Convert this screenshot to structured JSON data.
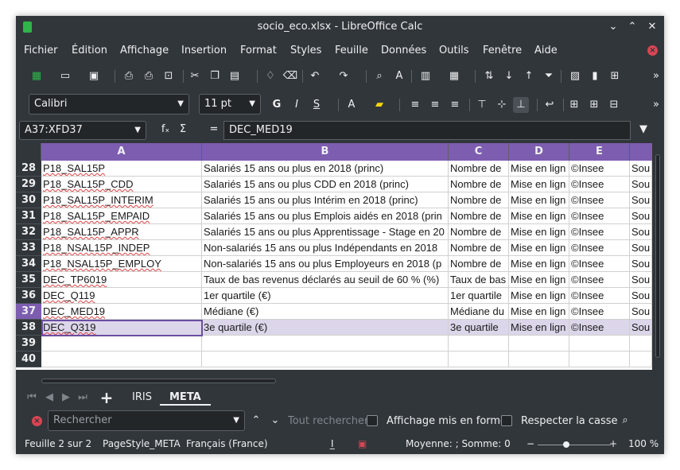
{
  "window": {
    "title": "socio_eco.xlsx - LibreOffice Calc",
    "minimize_glyph": "⌄",
    "maximize_glyph": "⌃",
    "close_glyph": "✕"
  },
  "menu": {
    "items": [
      "Fichier",
      "Édition",
      "Affichage",
      "Insertion",
      "Format",
      "Styles",
      "Feuille",
      "Données",
      "Outils",
      "Fenêtre",
      "Aide"
    ]
  },
  "toolbar": {
    "font_name": "Calibri",
    "font_size": "11 pt",
    "bold": "G",
    "italic": "I",
    "underline": "S",
    "more": "»"
  },
  "formula_bar": {
    "name_box": "A37:XFD37",
    "fx": "fₓ",
    "sigma": "Σ",
    "equals": "=",
    "content": "DEC_MED19"
  },
  "grid": {
    "columns": [
      "A",
      "B",
      "C",
      "D",
      "E"
    ],
    "rows": [
      {
        "num": "28",
        "a": "P18_SAL15P",
        "b": "Salariés 15 ans ou plus en 2018 (princ)",
        "c": "Nombre de",
        "d": "Mise en lign",
        "e": "©Insee",
        "f": "Sou"
      },
      {
        "num": "29",
        "a": "P18_SAL15P_CDD",
        "b": "Salariés 15 ans ou plus CDD en 2018 (princ)",
        "c": "Nombre de",
        "d": "Mise en lign",
        "e": "©Insee",
        "f": "Sou"
      },
      {
        "num": "30",
        "a": "P18_SAL15P_INTERIM",
        "b": "Salariés 15 ans ou plus Intérim en 2018 (princ)",
        "c": "Nombre de",
        "d": "Mise en lign",
        "e": "©Insee",
        "f": "Sou"
      },
      {
        "num": "31",
        "a": "P18_SAL15P_EMPAID",
        "b": "Salariés 15 ans ou plus Emplois aidés en 2018 (prin",
        "c": "Nombre de",
        "d": "Mise en lign",
        "e": "©Insee",
        "f": "Sou"
      },
      {
        "num": "32",
        "a": "P18_SAL15P_APPR",
        "b": "Salariés 15 ans ou plus Apprentissage - Stage en 20",
        "c": "Nombre de",
        "d": "Mise en lign",
        "e": "©Insee",
        "f": "Sou"
      },
      {
        "num": "33",
        "a": "P18_NSAL15P_INDEP",
        "b": "Non-salariés 15 ans ou plus Indépendants en 2018",
        "c": "Nombre de",
        "d": "Mise en lign",
        "e": "©Insee",
        "f": "Sou"
      },
      {
        "num": "34",
        "a": "P18_NSAL15P_EMPLOY",
        "b": "Non-salariés 15 ans ou plus Employeurs en 2018 (p",
        "c": "Nombre de",
        "d": "Mise en lign",
        "e": "©Insee",
        "f": "Sou"
      },
      {
        "num": "35",
        "a": "DEC_TP6019",
        "b": "Taux de bas revenus déclarés au seuil de 60 % (%)",
        "c": "Taux de bas",
        "d": "Mise en lign",
        "e": "©Insee",
        "f": "Sou"
      },
      {
        "num": "36",
        "a": "DEC_Q119",
        "b": "1er quartile (€)",
        "c": "1er quartile",
        "d": "Mise en lign",
        "e": "©Insee",
        "f": "Sou"
      },
      {
        "num": "37",
        "a": "DEC_MED19",
        "b": "Médiane (€)",
        "c": "Médiane du",
        "d": "Mise en lign",
        "e": "©Insee",
        "f": "Sou"
      },
      {
        "num": "38",
        "a": "DEC_Q319",
        "b": "3e quartile (€)",
        "c": "3e quartile",
        "d": "Mise en lign",
        "e": "©Insee",
        "f": "Sou"
      },
      {
        "num": "39",
        "a": "",
        "b": "",
        "c": "",
        "d": "",
        "e": "",
        "f": ""
      },
      {
        "num": "40",
        "a": "",
        "b": "",
        "c": "",
        "d": "",
        "e": "",
        "f": ""
      }
    ]
  },
  "sheet_tabs": {
    "add": "+",
    "tabs": [
      "IRIS",
      "META"
    ],
    "active": "META"
  },
  "find": {
    "placeholder": "Rechercher",
    "find_all": "Tout rechercher",
    "formatted_display": "Affichage mis en forme",
    "match_case": "Respecter la casse"
  },
  "status": {
    "sheet": "Feuille 2 sur 2",
    "page_style": "PageStyle_META",
    "language": "Français (France)",
    "summary": "Moyenne: ; Somme: 0",
    "zoom_minus": "−",
    "zoom_plus": "+",
    "zoom": "100 %",
    "zoom_level": 100
  },
  "colors": {
    "accent": "#7d5db0",
    "selection_band": "#dcd6ea",
    "chrome": "#31363b"
  }
}
